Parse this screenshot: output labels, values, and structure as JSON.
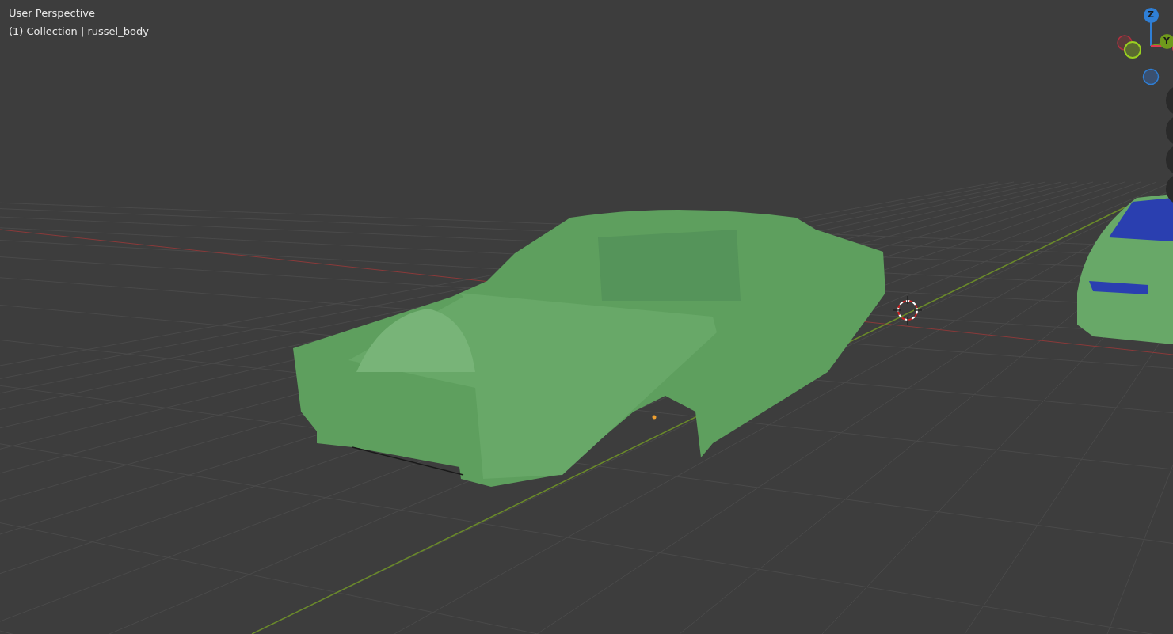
{
  "viewport": {
    "view_name": "User Perspective",
    "object_info": "(1) Collection | russel_body"
  },
  "gizmo": {
    "axes": [
      {
        "label": "Z",
        "color": "#2f7fd6"
      },
      {
        "label": "Y",
        "color": "#6f9a1c"
      }
    ]
  }
}
